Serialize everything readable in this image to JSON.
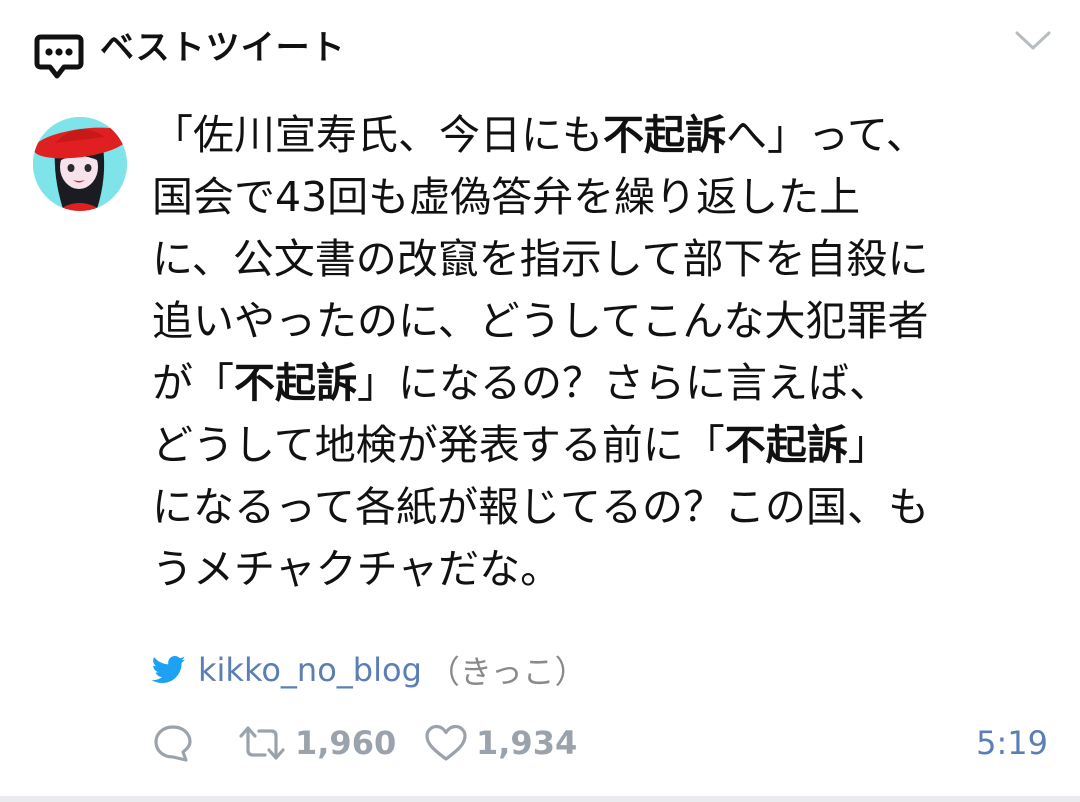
{
  "header": {
    "title": "ベストツイート",
    "icon": "comment-bubble-icon",
    "menu_icon": "chevron-down-icon"
  },
  "avatar": {
    "icon": "avatar-illustration"
  },
  "tweet": {
    "lines": [
      [
        "「佐川宣寿氏、今日にも",
        "不起訴",
        "へ」って、"
      ],
      [
        "国会で43回も虚偽答弁を繰り返した上"
      ],
      [
        "に、公文書の改竄を指示して部下を自殺に"
      ],
      [
        "追いやったのに、どうしてこんな大犯罪者"
      ],
      [
        "が「",
        "不起訴",
        "」になるの？さらに言えば、"
      ],
      [
        "どうして地検が発表する前に「",
        "不起訴",
        "」"
      ],
      [
        "になるって各紙が報じてるの？この国、も"
      ],
      [
        "うメチャクチャだな。"
      ]
    ]
  },
  "author": {
    "handle": "kikko_no_blog",
    "name": "（きっこ）",
    "icon": "twitter-bird-icon"
  },
  "actions": {
    "reply_icon": "reply-icon",
    "retweet_icon": "retweet-icon",
    "retweet_count": "1,960",
    "like_icon": "heart-icon",
    "like_count": "1,934"
  },
  "time": "5:19",
  "colors": {
    "link": "#5b7fb5",
    "muted": "#9aa3ab",
    "twitter_blue": "#1da1f2",
    "avatar_bg": "#7fe3ea",
    "hat_red": "#e02020"
  }
}
